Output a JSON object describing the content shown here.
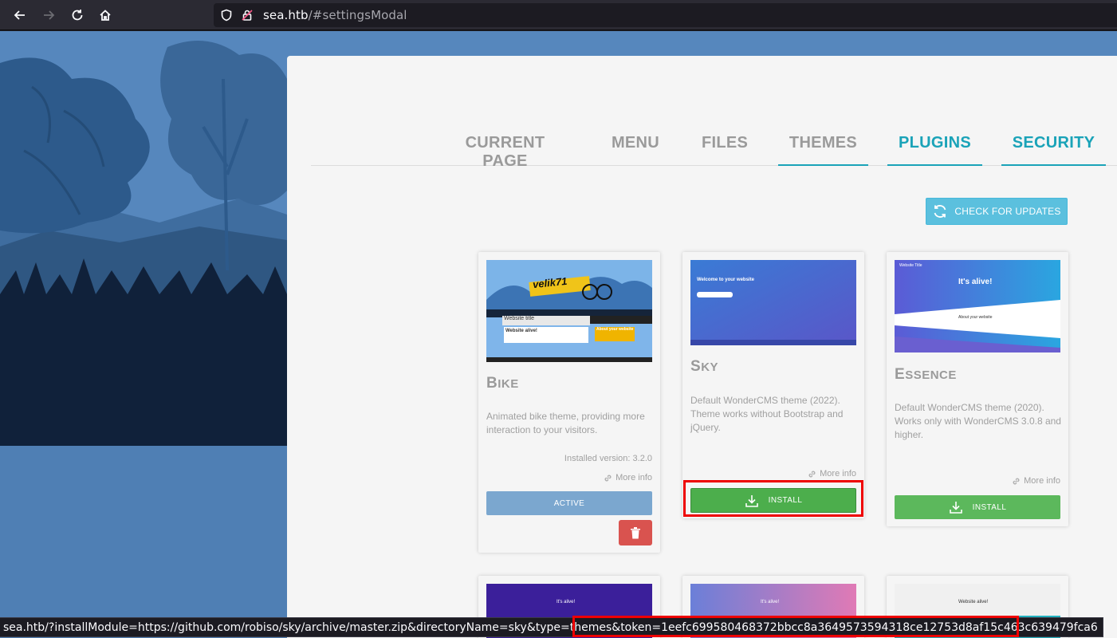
{
  "browser": {
    "url_host": "sea.htb",
    "url_path": "/#settingsModal",
    "status_url": "sea.htb/?installModule=https://github.com/robiso/sky/archive/master.zip&directoryName=sky&type=themes&",
    "status_token": "token=1eefc699580468372bbcc8a3649573594318ce12753d8af15c463c639479fca6"
  },
  "tabs": [
    {
      "label": "CURRENT PAGE"
    },
    {
      "label": "MENU"
    },
    {
      "label": "FILES"
    },
    {
      "label": "THEMES"
    },
    {
      "label": "PLUGINS"
    },
    {
      "label": "SECURITY"
    }
  ],
  "check_updates_label": "CHECK FOR UPDATES",
  "themes": [
    {
      "title_cap": "B",
      "title_rest": "IKE",
      "thumb_logo": "velik71",
      "thumb_site_title": "Website title",
      "thumb_alive": "Website alive!",
      "thumb_about": "About your website",
      "description": "Animated bike theme, providing more interaction to your visitors.",
      "installed_version": "Installed version: 3.2.0",
      "more_info": "More info",
      "button_label": "ACTIVE"
    },
    {
      "title_cap": "S",
      "title_rest": "KY",
      "thumb_welcome": "Welcome to your website",
      "description": "Default WonderCMS theme (2022). Theme works without Bootstrap and jQuery.",
      "more_info": "More info",
      "button_label": "INSTALL"
    },
    {
      "title_cap": "E",
      "title_rest": "SSENCE",
      "thumb_alive": "It's alive!",
      "thumb_about": "About your website",
      "thumb_site": "Website Title",
      "description": "Default WonderCMS theme (2020). Works only with WonderCMS 3.0.8 and higher.",
      "more_info": "More info",
      "button_label": "INSTALL"
    }
  ],
  "bottom_thumbs": [
    {
      "alive": "It's alive!"
    },
    {
      "alive": "It's alive!"
    },
    {
      "alive": "Website alive!"
    }
  ],
  "colors": {
    "accent": "#1aa3b8",
    "install": "#4cae4c",
    "active": "#7ba7cf",
    "delete": "#d9534f",
    "highlight": "#ee0000"
  }
}
